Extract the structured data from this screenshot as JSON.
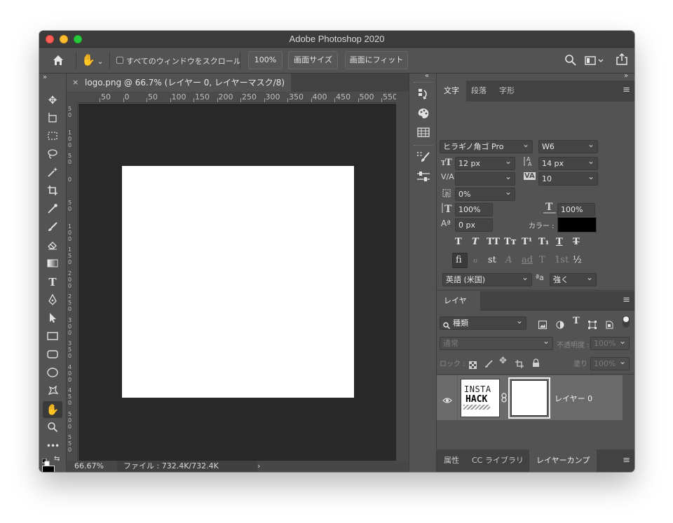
{
  "window": {
    "title": "Adobe Photoshop 2020"
  },
  "options_bar": {
    "home_icon": "home-icon",
    "hand_icon": "hand-icon",
    "scroll_all_label": "すべてのウィンドウをスクロール",
    "zoom_100": "100%",
    "fit_screen": "画面サイズ",
    "fill_screen": "画面にフィット",
    "right_icons": [
      "search-icon",
      "workspace-icon",
      "share-icon"
    ]
  },
  "document": {
    "tab_title": "logo.png @ 66.7% (レイヤー 0, レイヤーマスク/8) *",
    "tab_close": "×",
    "ruler_h_labels": [
      "50",
      "0",
      "50",
      "100",
      "150",
      "200",
      "250",
      "300",
      "350",
      "400",
      "450",
      "500",
      "550"
    ],
    "ruler_v_labels": [
      "5 0",
      "1 0 0",
      "5 0",
      "0",
      "5 0",
      "1 0 0",
      "1 5 0",
      "2 0 0",
      "2 5 0",
      "3 0 0",
      "3 5 0",
      "4 0 0",
      "4 5 0",
      "5 0 0",
      "5 5 0"
    ]
  },
  "status": {
    "zoom": "66.67%",
    "file_info": "ファイル : 732.4K/732.4K",
    "arrow": "›"
  },
  "character_panel": {
    "tabs": [
      "文字",
      "段落",
      "字形"
    ],
    "font_family": "ヒラギノ角ゴ Pro",
    "font_weight": "W6",
    "font_size": "12 px",
    "leading": "14 px",
    "kerning": "",
    "tracking": "10",
    "tsume": "0%",
    "vertical_scale": "100%",
    "horizontal_scale": "100%",
    "baseline_shift": "0 px",
    "color_label": "カラー :",
    "text_color": "#000000",
    "format_buttons": [
      "T",
      "T",
      "TT",
      "Tт",
      "T¹",
      "T₁",
      "T",
      "T"
    ],
    "opentype_buttons": [
      "fi",
      "ℴ",
      "st",
      "A",
      "ad",
      "T",
      "1st",
      "½"
    ],
    "language": "英語 (米国)",
    "aa_label": "ªa",
    "antialias": "強く"
  },
  "layers_panel": {
    "tab": "レイヤー",
    "filter_kind": "種類",
    "blend_mode": "通常",
    "opacity_label": "不透明度 :",
    "opacity_value": "100%",
    "lock_label": "ロック :",
    "fill_label": "塗り :",
    "fill_value": "100%",
    "layers": [
      {
        "name": "レイヤー 0",
        "thumb_line1": "INSTA",
        "thumb_line2": "HACK"
      }
    ]
  },
  "bottom_tabs": [
    "属性",
    "CC ライブラリ",
    "レイヤーカンプ"
  ],
  "colors": {
    "chrome": "#535353",
    "canvas_bg": "#282828",
    "titlebar": "#3c3c3c"
  }
}
